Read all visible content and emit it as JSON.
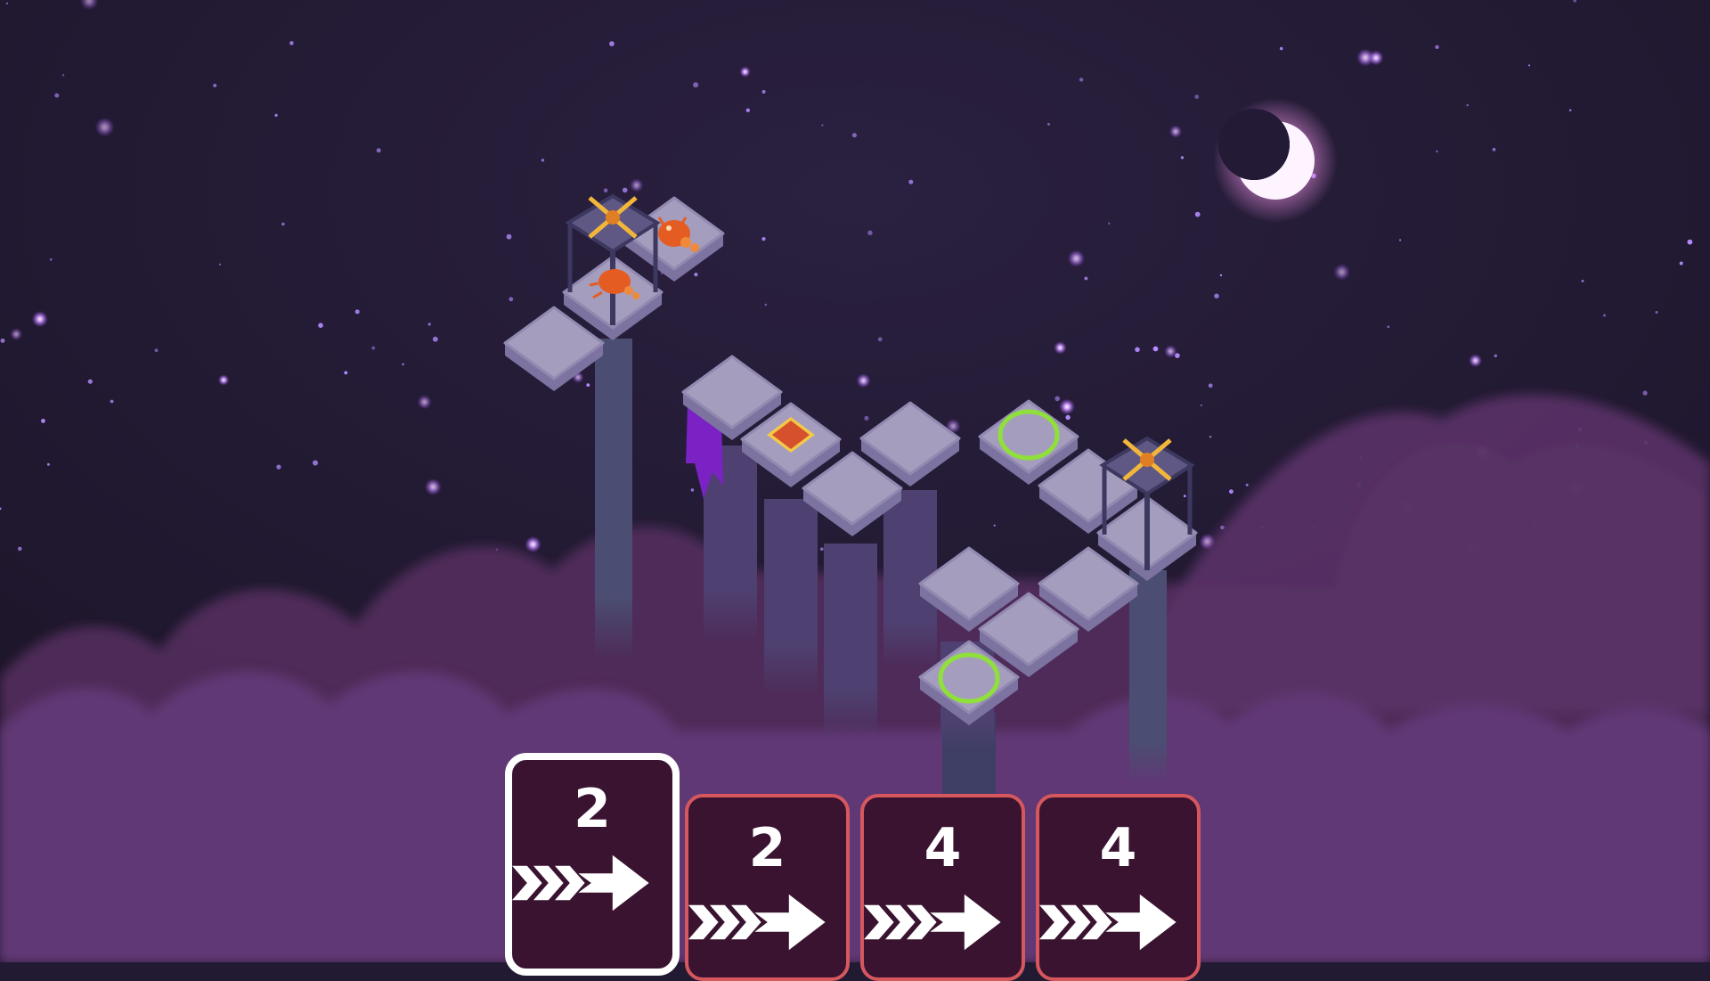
{
  "colors": {
    "sky": "#221a33",
    "cloud": "#6c3b82",
    "tile_top": "#a59dbd",
    "tile_side": "#7c73a0",
    "pillar": "#4b4e72",
    "banner": "#7a22c4",
    "goal_ring": "#8fe03a",
    "switch": "#d6502c",
    "card_bg": "#3a1330",
    "card_border": "#d6585e",
    "card_selected_border": "#ffffff",
    "moon": "#fdf4ff"
  },
  "scene": {
    "moon_icon": "crescent-moon-icon",
    "creature_icon": "orange-bug-creature-icon",
    "tower_icon": "crossbow-tower-icon",
    "goal_icon": "green-ring-goal-icon",
    "switch_icon": "orange-pressure-switch-icon"
  },
  "move_cards": [
    {
      "steps": "2",
      "icon": "triple-chevron-arrow-icon",
      "selected": true
    },
    {
      "steps": "2",
      "icon": "triple-chevron-arrow-icon",
      "selected": false
    },
    {
      "steps": "4",
      "icon": "triple-chevron-arrow-icon",
      "selected": false
    },
    {
      "steps": "4",
      "icon": "triple-chevron-arrow-icon",
      "selected": false
    }
  ]
}
